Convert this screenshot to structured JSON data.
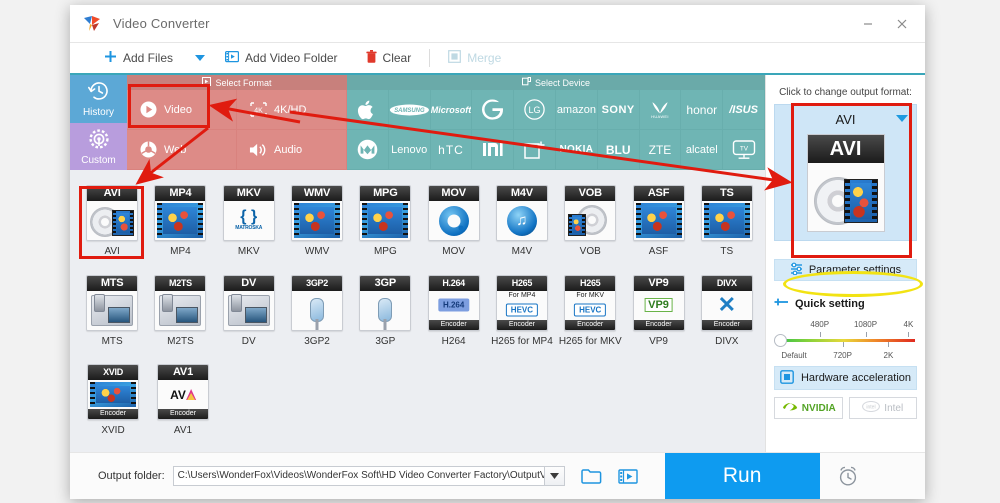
{
  "window": {
    "title": "Video Converter",
    "logo_icon": "wonderfox-logo-icon",
    "minimize_label": "–",
    "close_label": "✕"
  },
  "toolbar": {
    "add_files": "Add Files",
    "add_files_icon": "plus-icon",
    "dropdown_icon": "chevron-down-icon",
    "add_video_folder": "Add Video Folder",
    "add_video_folder_icon": "folder-video-icon",
    "clear": "Clear",
    "clear_icon": "trash-icon",
    "merge": "Merge",
    "merge_icon": "merge-squares-icon"
  },
  "sidebar": {
    "items": [
      {
        "label": "History",
        "icon": "history-clock-icon",
        "color": "#5ca8d6"
      },
      {
        "label": "Custom",
        "icon": "gear-target-icon",
        "color": "#b89ddd"
      }
    ]
  },
  "strip": {
    "format_header": "Select Format",
    "format_header_icon": "format-icon",
    "device_header": "Select Device",
    "device_header_icon": "device-icon",
    "categories": [
      {
        "label": "Video",
        "icon": "play-circle-icon",
        "selected": true
      },
      {
        "label": "4K/HD",
        "icon": "4k-icon",
        "selected": false
      },
      {
        "label": "Web",
        "icon": "chrome-icon",
        "selected": false
      },
      {
        "label": "Audio",
        "icon": "speaker-icon",
        "selected": false
      }
    ],
    "devices_row1": [
      {
        "label": "Apple",
        "icon": "apple-logo-icon"
      },
      {
        "label": "SAMSUNG",
        "icon": "samsung-logo-icon"
      },
      {
        "label": "Microsoft",
        "icon": "microsoft-logo-icon"
      },
      {
        "label": "G",
        "icon": "google-logo-icon"
      },
      {
        "label": "LG",
        "icon": "lg-logo-icon"
      },
      {
        "label": "amazon",
        "icon": "amazon-logo-icon"
      },
      {
        "label": "SONY",
        "icon": "sony-logo-icon"
      },
      {
        "label": "HUAWEI",
        "icon": "huawei-logo-icon"
      },
      {
        "label": "honor",
        "icon": "honor-logo-icon"
      },
      {
        "label": "/ISUS",
        "icon": "asus-logo-icon"
      }
    ],
    "devices_row2": [
      {
        "label": "Motorola",
        "icon": "motorola-logo-icon"
      },
      {
        "label": "Lenovo",
        "icon": "lenovo-logo-icon"
      },
      {
        "label": "hTC",
        "icon": "htc-logo-icon"
      },
      {
        "label": "mi",
        "icon": "xiaomi-logo-icon"
      },
      {
        "label": "Add device",
        "icon": "add-device-icon"
      },
      {
        "label": "NOKIA",
        "icon": "nokia-logo-icon"
      },
      {
        "label": "BLU",
        "icon": "blu-logo-icon"
      },
      {
        "label": "ZTE",
        "icon": "zte-logo-icon"
      },
      {
        "label": "alcatel",
        "icon": "alcatel-logo-icon"
      },
      {
        "label": "TV",
        "icon": "tv-icon"
      }
    ]
  },
  "formats": {
    "row1": [
      {
        "label": "AVI",
        "cap": "AVI",
        "art": "disc-film",
        "selected": true
      },
      {
        "label": "MP4",
        "cap": "MP4",
        "art": "film"
      },
      {
        "label": "MKV",
        "cap": "MKV",
        "art": "matroska"
      },
      {
        "label": "WMV",
        "cap": "WMV",
        "art": "film"
      },
      {
        "label": "MPG",
        "cap": "MPG",
        "art": "film"
      },
      {
        "label": "MOV",
        "cap": "MOV",
        "art": "quicktime"
      },
      {
        "label": "M4V",
        "cap": "M4V",
        "art": "note"
      },
      {
        "label": "VOB",
        "cap": "VOB",
        "art": "disc-film"
      },
      {
        "label": "ASF",
        "cap": "ASF",
        "art": "film"
      },
      {
        "label": "TS",
        "cap": "TS",
        "art": "film"
      }
    ],
    "row2": [
      {
        "label": "MTS",
        "cap": "MTS",
        "art": "camcorder"
      },
      {
        "label": "M2TS",
        "cap": "M2TS",
        "art": "camcorder"
      },
      {
        "label": "DV",
        "cap": "DV",
        "art": "camcorder"
      },
      {
        "label": "3GP2",
        "cap": "3GP2",
        "art": "phone"
      },
      {
        "label": "3GP",
        "cap": "3GP",
        "art": "phone"
      },
      {
        "label": "H264",
        "cap": "H.264",
        "art": "h264",
        "sub": "",
        "encoder": "Encoder"
      },
      {
        "label": "H265 for MP4",
        "cap": "H265",
        "art": "hevc",
        "sub": "For MP4",
        "encoder": "Encoder"
      },
      {
        "label": "H265 for MKV",
        "cap": "H265",
        "art": "hevc",
        "sub": "For MKV",
        "encoder": "Encoder"
      },
      {
        "label": "VP9",
        "cap": "VP9",
        "art": "vp9",
        "encoder": "Encoder"
      },
      {
        "label": "DIVX",
        "cap": "DIVX",
        "art": "divx",
        "encoder": "Encoder"
      }
    ],
    "row3": [
      {
        "label": "XVID",
        "cap": "XVID",
        "art": "film",
        "encoder": "Encoder"
      },
      {
        "label": "AV1",
        "cap": "AV1",
        "art": "av1",
        "encoder": "Encoder"
      }
    ]
  },
  "right_panel": {
    "hint": "Click to change output format:",
    "output_format": "AVI",
    "dropdown_icon": "caret-down-icon",
    "thumb_cap": "AVI",
    "parameter_settings": "Parameter settings",
    "parameter_settings_icon": "sliders-icon",
    "quick_setting": "Quick setting",
    "quick_setting_icon": "plus-minus-icon",
    "slider": {
      "top_labels": [
        "480P",
        "1080P",
        "4K"
      ],
      "bottom_labels": [
        "Default",
        "720P",
        "2K"
      ],
      "value": "Default"
    },
    "hardware_acceleration": "Hardware acceleration",
    "hardware_acceleration_icon": "chip-icon",
    "gpu_nvidia": "NVIDIA",
    "gpu_nvidia_icon": "nvidia-logo-icon",
    "gpu_intel": "Intel",
    "gpu_intel_icon": "intel-logo-icon"
  },
  "footer": {
    "output_folder_label": "Output folder:",
    "output_folder_path": "C:\\Users\\WonderFox\\Videos\\WonderFox Soft\\HD Video Converter Factory\\OutputVideo\\",
    "dropdown_icon": "caret-down-icon",
    "browse_icon": "folder-open-icon",
    "preview_icon": "film-open-icon",
    "run_label": "Run",
    "alarm_icon": "alarm-clock-icon"
  },
  "annotations": {
    "highlight_color": "#e01b0f",
    "ellipse_color": "#f2e313"
  }
}
